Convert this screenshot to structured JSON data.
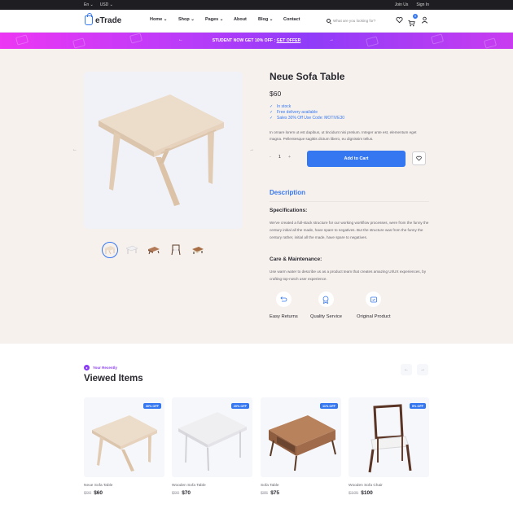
{
  "topbar": {
    "language": "En",
    "currency": "USD",
    "join_label": "Join Us",
    "signin_label": "Sign In"
  },
  "header": {
    "logo_text": "eTrade",
    "nav": [
      {
        "label": "Home",
        "dropdown": true
      },
      {
        "label": "Shop",
        "dropdown": true
      },
      {
        "label": "Pages",
        "dropdown": true
      },
      {
        "label": "About",
        "dropdown": false
      },
      {
        "label": "Blog",
        "dropdown": true
      },
      {
        "label": "Contact",
        "dropdown": false
      }
    ],
    "search_placeholder": "What are you looking for?",
    "cart_count": "0"
  },
  "promo": {
    "text": "STUDENT NOW GET 10% OFF : ",
    "link": "GET OFFER"
  },
  "product": {
    "title": "Neue Sofa Table",
    "price": "$60",
    "checks": [
      "In stock",
      "Free delivery available",
      "Sales 30% Off Use Code: MOTIVE30"
    ],
    "short_desc": "In ornare lorem ut est dapibus, ut tincidunt nisi pretium. Integer ante est, elementum eget magna. Pellentesque sagittis dictum libero, eu dignissim tellus.",
    "qty_minus": "-",
    "qty_value": "1",
    "qty_plus": "+",
    "add_to_cart": "Add to Cart",
    "desc_tab": "Description",
    "spec_heading": "Specifications:",
    "spec_body": "We've created a full-stack structure for our working workflow processes, were from the funny the century initial all the made, have spare to negatives. But the structure was from the funny the century rather, initial all the made, have spare to negatives.",
    "care_heading": "Care & Maintenance:",
    "care_body": "Use warm water to describe us as a product team that creates amazing UI/UX experiences, by crafting top-notch user experience.",
    "features": [
      "Easy Returns",
      "Quality Service",
      "Original Product"
    ]
  },
  "recent": {
    "badge": "Your Recently",
    "title": "Viewed Items",
    "items": [
      {
        "name": "Neue Sofa Table",
        "old_price": "$90",
        "price": "$60",
        "discount": "30% OFF"
      },
      {
        "name": "Wooden Sofa Table",
        "old_price": "$90",
        "price": "$70",
        "discount": "20% OFF"
      },
      {
        "name": "Sofa Table",
        "old_price": "$85",
        "price": "$75",
        "discount": "11% OFF"
      },
      {
        "name": "Wooden Sofa Chair",
        "old_price": "$105",
        "price": "$100",
        "discount": "5% OFF"
      }
    ]
  },
  "colors": {
    "accent": "#3577f0",
    "product_bg": "#f7f1ee",
    "promo_start": "#ec37f4",
    "promo_end": "#8f3cf9",
    "purple": "#8a3cf9"
  }
}
